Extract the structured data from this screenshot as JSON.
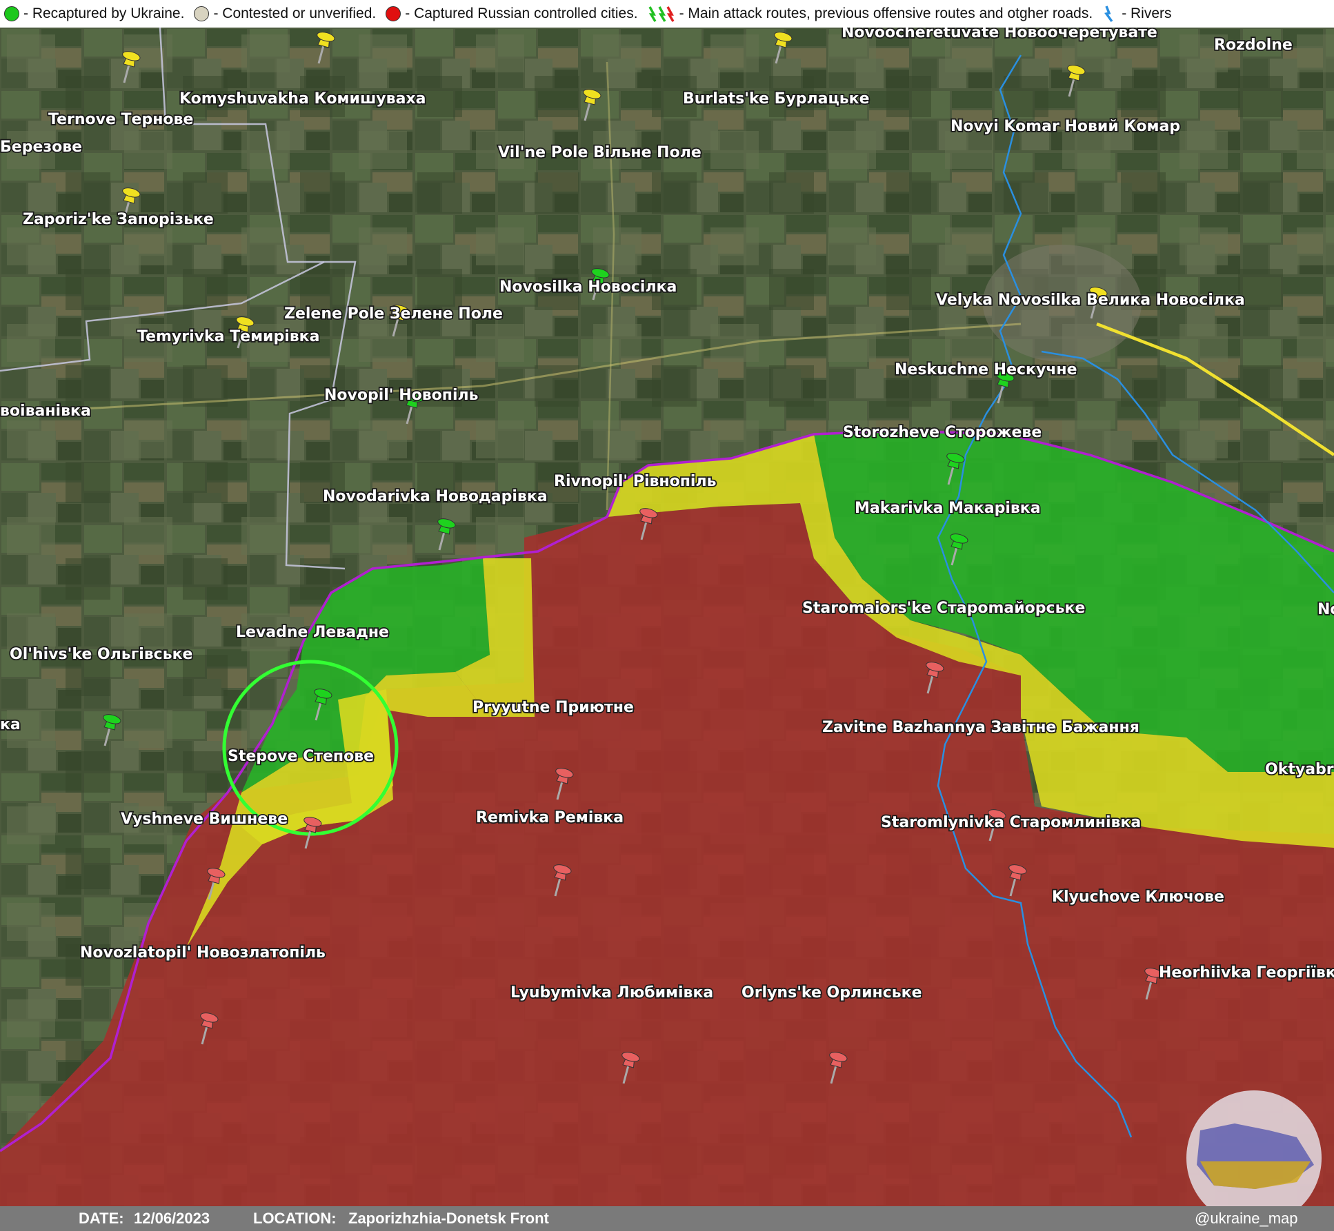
{
  "legend": {
    "recaptured": "- Recaptured by Ukraine.",
    "contested": "- Contested or unverified.",
    "captured": "- Captured Russian controlled cities.",
    "routes": "- Main attack routes, previous offensive routes and otgher roads.",
    "rivers": "- Rivers"
  },
  "colors": {
    "ukraine": "#27b327",
    "contested": "#d8d820",
    "russia": "#a5302c",
    "frontline": "#b020d0",
    "river": "#2a8fe0",
    "highlight": "#33ff33"
  },
  "footer": {
    "date_label": "DATE:",
    "date": "12/06/2023",
    "location_label": "LOCATION:",
    "location": "Zaporizhzhia-Donetsk Front",
    "handle": "@ukraine_map"
  },
  "places": [
    {
      "name": "Ternove Тернове",
      "status": "contested"
    },
    {
      "name": "Komyshuvakha Комишуваха",
      "status": "contested"
    },
    {
      "name": "Burlats'ke Бурлацьке",
      "status": "contested"
    },
    {
      "name": "Novoocheretuvate Новоочеретувате",
      "status": "none"
    },
    {
      "name": "Novyi Komar Новий Комар",
      "status": "contested"
    },
    {
      "name": "Березове",
      "status": "none"
    },
    {
      "name": "Vil'ne Pole Вільне Поле",
      "status": "contested"
    },
    {
      "name": "Zaporiz'ke Запорізьке",
      "status": "contested"
    },
    {
      "name": "Novosilka Новосілка",
      "status": "recaptured"
    },
    {
      "name": "Velyka Novosilka Велика Новосілка",
      "status": "contested"
    },
    {
      "name": "Zelene Pole Зелене Поле",
      "status": "contested"
    },
    {
      "name": "Temyrivka Темирівка",
      "status": "contested"
    },
    {
      "name": "Neskuchne Нескучне",
      "status": "recaptured"
    },
    {
      "name": "Novopil' Новопіль",
      "status": "recaptured"
    },
    {
      "name": "воіванівка",
      "status": "none"
    },
    {
      "name": "Storozheve Сторожеве",
      "status": "recaptured"
    },
    {
      "name": "Rivnopil' Рівнопіль",
      "status": "captured"
    },
    {
      "name": "Novodarivka Новодарівка",
      "status": "recaptured"
    },
    {
      "name": "Makarivka Макарівка",
      "status": "recaptured"
    },
    {
      "name": "Staromaiors'ke Староmaйорське",
      "status": "captured"
    },
    {
      "name": "No",
      "status": "none"
    },
    {
      "name": "Levadne Левадне",
      "status": "recaptured"
    },
    {
      "name": "Ol'hivs'ke Ольгівське",
      "status": "recaptured"
    },
    {
      "name": "Pryyutne Приютне",
      "status": "captured"
    },
    {
      "name": "Zavitne Bazhannya Завітне Бажання",
      "status": "captured"
    },
    {
      "name": "ка",
      "status": "none"
    },
    {
      "name": "Stepove Степове",
      "status": "captured"
    },
    {
      "name": "Oktyabr",
      "status": "none"
    },
    {
      "name": "Vyshneve Вишневе",
      "status": "captured"
    },
    {
      "name": "Remivka Ремівка",
      "status": "captured"
    },
    {
      "name": "Staromlynivka Старомлинівка",
      "status": "captured"
    },
    {
      "name": "Klyuchove Ключове",
      "status": "captured"
    },
    {
      "name": "Novozlatopil' Новозлатопіль",
      "status": "captured"
    },
    {
      "name": "Heorhiivka Георгіївка",
      "status": "captured"
    },
    {
      "name": "Lyubymivka Любимівка",
      "status": "captured"
    },
    {
      "name": "Orlyns'ke Орлинське",
      "status": "captured"
    },
    {
      "name": "Rozdolne",
      "status": "none"
    }
  ]
}
